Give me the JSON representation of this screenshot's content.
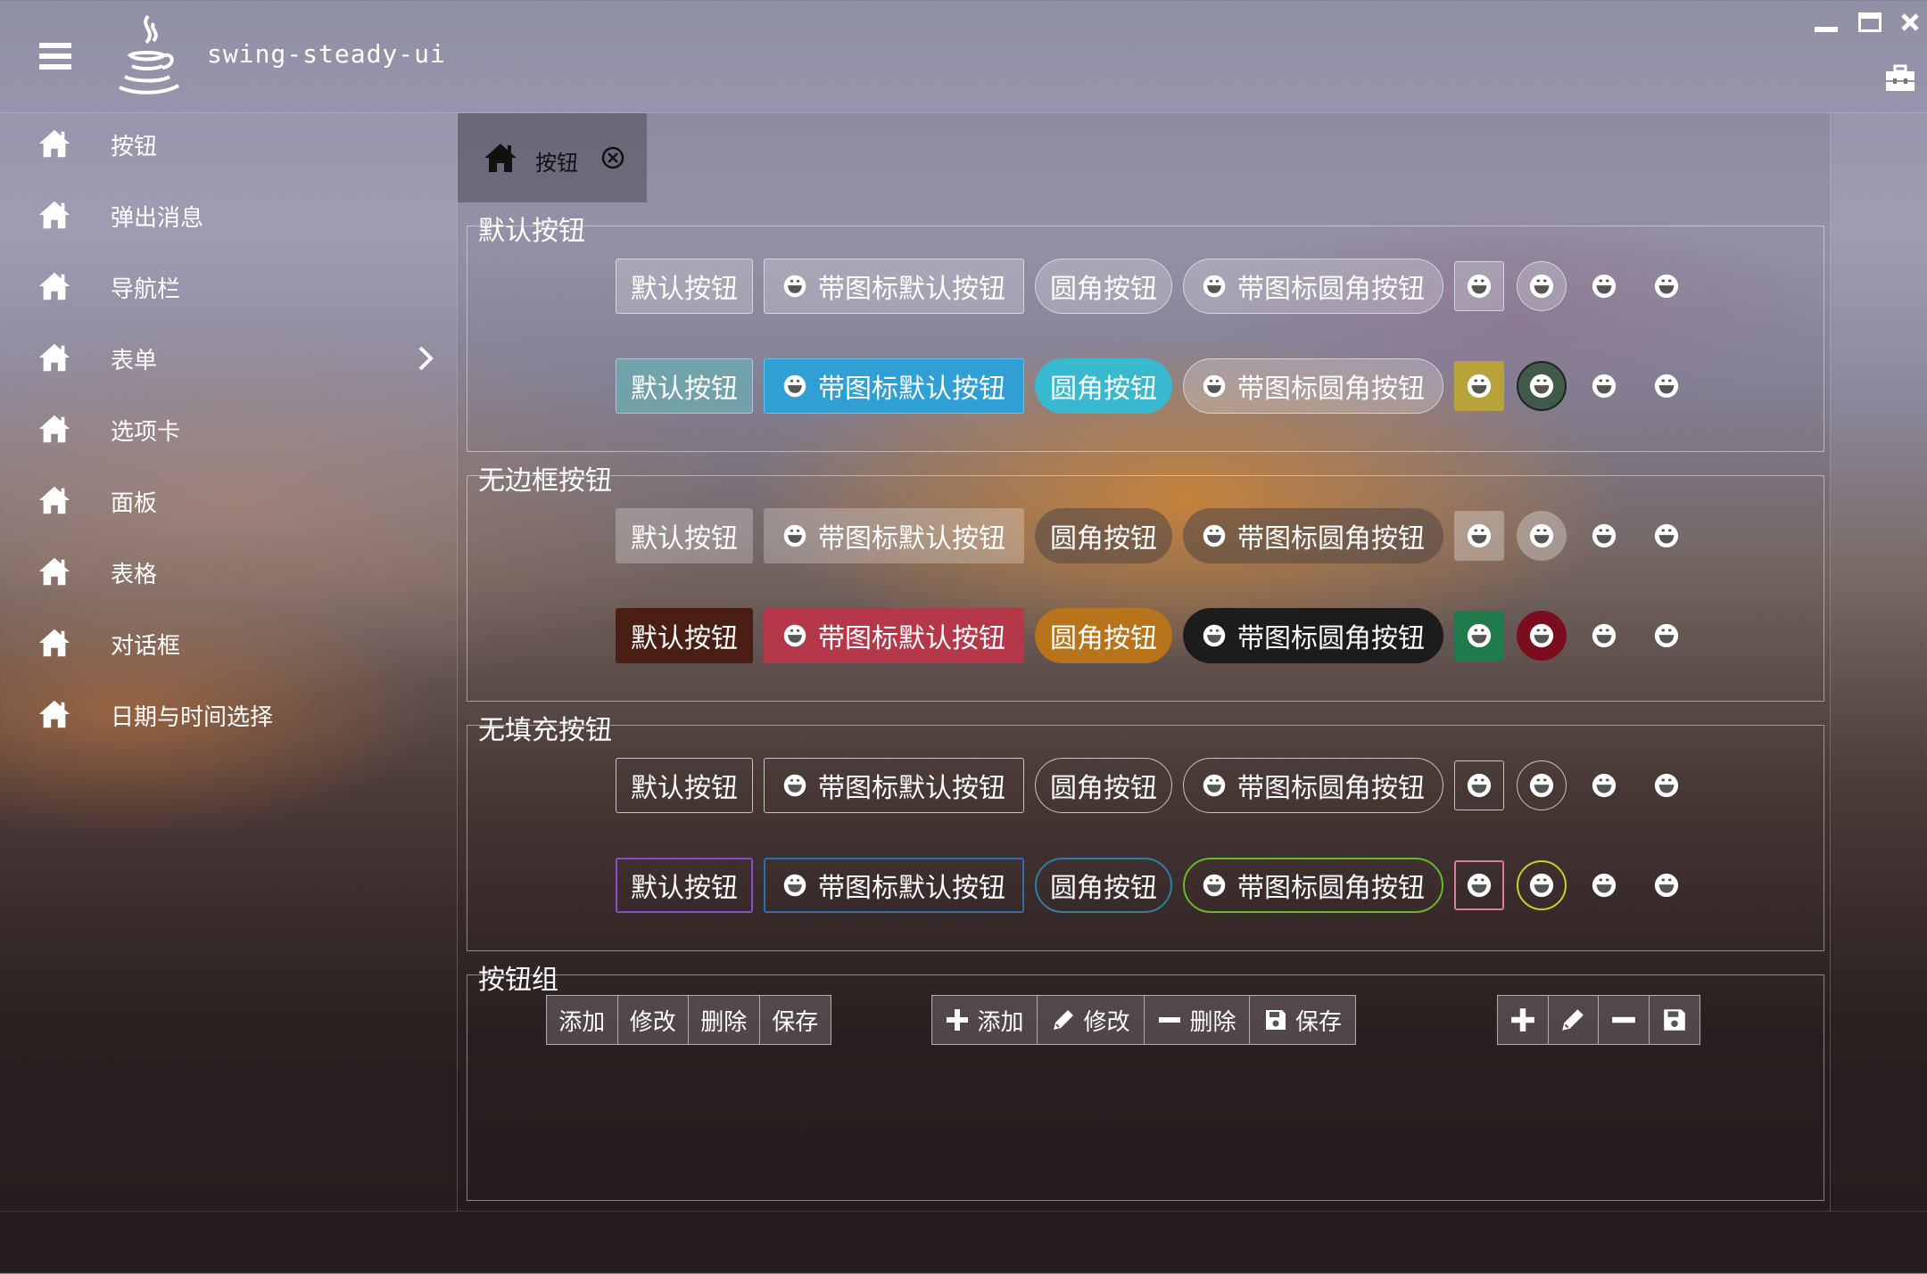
{
  "app": {
    "title": "swing-steady-ui"
  },
  "sidebar": {
    "items": [
      {
        "label": "按钮"
      },
      {
        "label": "弹出消息"
      },
      {
        "label": "导航栏"
      },
      {
        "label": "表单"
      },
      {
        "label": "选项卡"
      },
      {
        "label": "面板"
      },
      {
        "label": "表格"
      },
      {
        "label": "对话框"
      },
      {
        "label": "日期与时间选择"
      }
    ]
  },
  "tab": {
    "label": "按钮"
  },
  "sections": {
    "default": "默认按钮",
    "borderless": "无边框按钮",
    "nofill": "无填充按钮",
    "group": "按钮组"
  },
  "labels": {
    "default_btn": "默认按钮",
    "icon_default_btn": "带图标默认按钮",
    "round_btn": "圆角按钮",
    "icon_round_btn": "带图标圆角按钮"
  },
  "group": {
    "add": "添加",
    "edit": "修改",
    "delete": "删除",
    "save": "保存"
  },
  "colors": {
    "primary": "#2f9fd4",
    "info": "#39b9cf",
    "warning_olive": "#b8a23a",
    "success_dark": "#3f5a48",
    "dark_brown": "#4a1e12",
    "danger": "#b5384a",
    "amber": "#b8741a",
    "black": "#1c1c1c",
    "green": "#1f7a4c",
    "crimson": "#7a0d1e",
    "purple": "#8a4fd1",
    "blue_border": "#2b6fb0",
    "green_border": "#6ab82a",
    "pink_border": "#e07a9a",
    "yellow_border": "#c8d22a"
  }
}
